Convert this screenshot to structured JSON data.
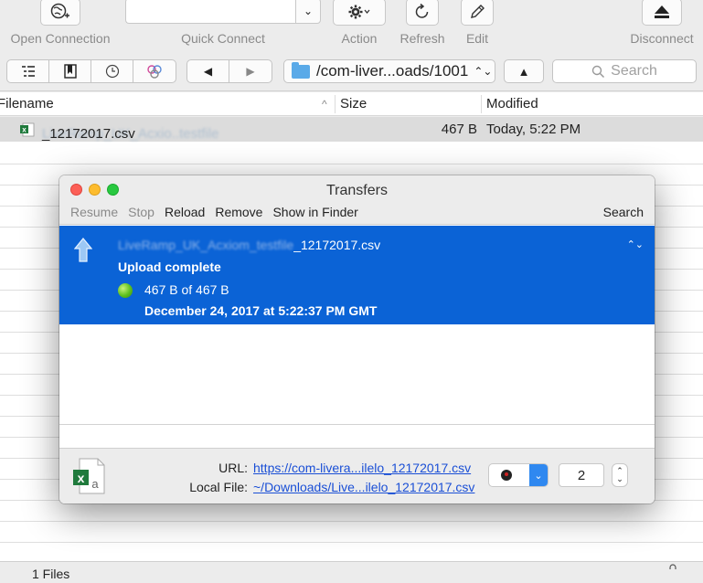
{
  "toolbar": {
    "open_connection": "Open Connection",
    "quick_connect": "Quick Connect",
    "action": "Action",
    "refresh": "Refresh",
    "edit": "Edit",
    "disconnect": "Disconnect"
  },
  "navbar": {
    "path": "/com-liver...oads/1001",
    "search_placeholder": "Search"
  },
  "browser": {
    "columns": {
      "filename": "Filename",
      "size": "Size",
      "modified": "Modified"
    },
    "file": {
      "name_prefix": "LiveRamp_UK_Acxio..testfile",
      "name_suffix": "_12172017.csv",
      "size": "467 B",
      "modified": "Today, 5:22 PM"
    },
    "status": "1 Files"
  },
  "transfers": {
    "title": "Transfers",
    "actions": {
      "resume": "Resume",
      "stop": "Stop",
      "reload": "Reload",
      "remove": "Remove",
      "show_in_finder": "Show in Finder",
      "search": "Search"
    },
    "item": {
      "name_prefix": "LiveRamp_UK_Acxiom_testfile",
      "name_suffix": "_12172017.csv",
      "status": "Upload complete",
      "progress": "467 B of 467 B",
      "date": "December 24, 2017 at 5:22:37 PM GMT"
    },
    "url_label": "URL:",
    "url": "https://com-livera...ilelo_12172017.csv",
    "local_label": "Local File:",
    "local_file": "~/Downloads/Live...ilelo_12172017.csv",
    "connections": "2"
  },
  "colors": {
    "selection": "#0b63d6",
    "folder": "#5aaae8",
    "link": "#1a4fd6"
  }
}
